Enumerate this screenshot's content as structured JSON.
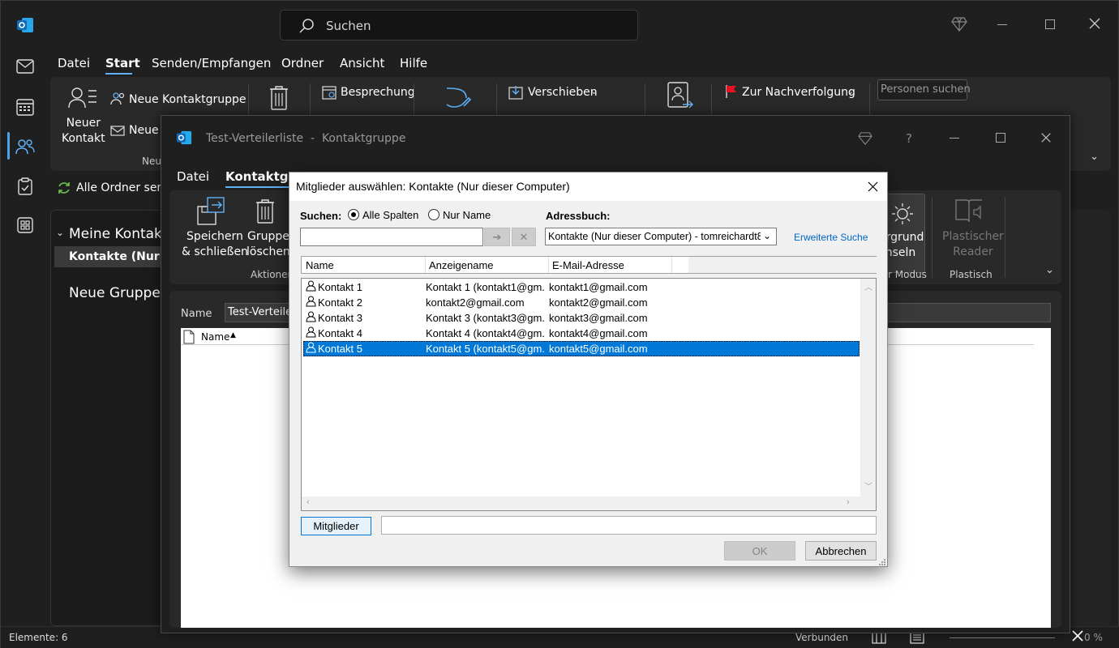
{
  "titlebar": {
    "search_placeholder": "Suchen"
  },
  "menu": {
    "items": [
      "Datei",
      "Start",
      "Senden/Empfangen",
      "Ordner",
      "Ansicht",
      "Hilfe"
    ]
  },
  "ribbon": {
    "new_contact": "Neuer\nKontakt",
    "new_contact_group": "Neue Kontaktgruppe",
    "new_other": "Neue I",
    "group_new": "Neu",
    "meeting": "Besprechung",
    "move": "Verschieben",
    "followup": "Zur Nachverfolgung",
    "find_people": "Personen suchen",
    "address_book": "Adressbuch"
  },
  "cmdbar": {
    "send_all": "Alle Ordner send"
  },
  "nav": {
    "my_contacts": "Meine Kontakte",
    "folder": "Kontakte (Nur di",
    "new_group": "Neue Gruppe"
  },
  "statusbar": {
    "items": "Elemente: 6",
    "connected": "Verbunden",
    "zoom": "0 %"
  },
  "cg_window": {
    "title": "Test-Verteilerliste  -  Kontaktgruppe",
    "tabs": [
      "Datei",
      "Kontaktgru"
    ],
    "save_close": "Speichern\n& schließen",
    "delete_group": "Gruppe\nlöschen",
    "group_actions": "Aktionen",
    "bg_switch": "ergrund\nchseln",
    "mode": "r Modus",
    "immersive_reader": "Plastischer\nReader",
    "immersive": "Plastisch",
    "name_label": "Name",
    "name_value": "Test-Verteilerl",
    "col_name": "Name"
  },
  "dialog": {
    "title": "Mitglieder auswählen: Kontakte (Nur dieser Computer)",
    "search_label": "Suchen:",
    "radio_all": "Alle Spalten",
    "radio_name": "Nur Name",
    "addressbook_label": "Adressbuch:",
    "addressbook_value": "Kontakte (Nur dieser Computer) - tomreichardt8",
    "advanced_search": "Erweiterte Suche",
    "columns": [
      "Name",
      "Anzeigename",
      "E-Mail-Adresse"
    ],
    "rows": [
      {
        "name": "Kontakt 1",
        "display": "Kontakt 1 (kontakt1@gm...",
        "email": "kontakt1@gmail.com",
        "selected": false
      },
      {
        "name": "Kontakt 2",
        "display": "kontakt2@gmail.com",
        "email": "kontakt2@gmail.com",
        "selected": false
      },
      {
        "name": "Kontakt 3",
        "display": "Kontakt 3 (kontakt3@gm...",
        "email": "kontakt3@gmail.com",
        "selected": false
      },
      {
        "name": "Kontakt 4",
        "display": "Kontakt 4 (kontakt4@gm...",
        "email": "kontakt4@gmail.com",
        "selected": false
      },
      {
        "name": "Kontakt 5",
        "display": "Kontakt 5 (kontakt5@gm...",
        "email": "kontakt5@gmail.com",
        "selected": true
      }
    ],
    "members_button": "Mitglieder",
    "ok_button": "OK",
    "cancel_button": "Abbrechen"
  },
  "colors": {
    "accent": "#0078d7",
    "link": "#0066cc",
    "dark_bg": "#1f1f1f",
    "ribbon_bg": "#292929"
  }
}
